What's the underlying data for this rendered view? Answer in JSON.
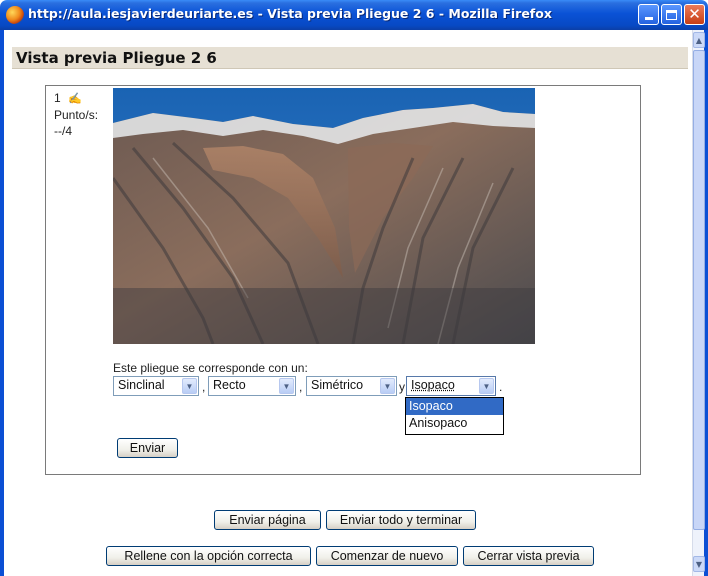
{
  "window": {
    "title": "http://aula.iesjavierdeuriarte.es - Vista previa Pliegue 2 6 - Mozilla Firefox"
  },
  "page": {
    "heading": "Vista previa Pliegue 2 6"
  },
  "question": {
    "number": "1",
    "edit_icon": "pencil-icon",
    "points_label": "Punto/s:",
    "points_value": "--/4",
    "prompt": "Este pliegue se corresponde con un:",
    "selects": [
      {
        "value": "Sinclinal"
      },
      {
        "value": "Recto"
      },
      {
        "value": "Simétrico"
      },
      {
        "value": "Isopaco"
      }
    ],
    "separators": [
      ",",
      ",",
      "y",
      "."
    ],
    "dropdown_options": [
      "Isopaco",
      "Anisopaco"
    ],
    "dropdown_selected": "Isopaco",
    "submit_label": "Enviar"
  },
  "footer": {
    "submit_page": "Enviar página",
    "submit_all": "Enviar todo y terminar",
    "fill_correct": "Rellene con la opción correcta",
    "restart": "Comenzar de nuevo",
    "close_preview": "Cerrar vista previa"
  },
  "colors": {
    "titlebar": "#0a52d6",
    "heading_bg": "#e6e0d4",
    "selected_option": "#316ac5"
  }
}
